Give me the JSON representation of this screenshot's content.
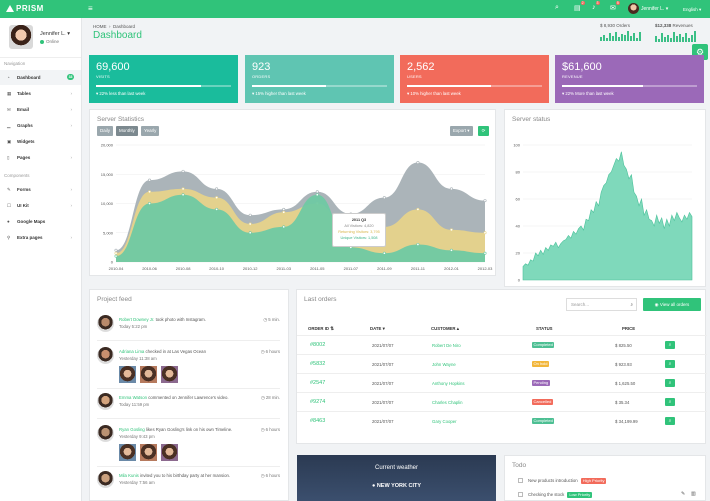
{
  "topbar": {
    "brand": "PRISM",
    "user_name": "Jennifer L.",
    "language": "English",
    "notif_badges": [
      "2",
      "3",
      "5"
    ]
  },
  "sidebar": {
    "user_name": "Jennifer L.",
    "user_status": "Online",
    "nav_heading": "Navigation",
    "components_heading": "Components",
    "items": [
      {
        "label": "Dashboard",
        "icon": "dashboard-icon",
        "badge": "33",
        "active": true
      },
      {
        "label": "Tables",
        "icon": "table-icon"
      },
      {
        "label": "Email",
        "icon": "email-icon"
      },
      {
        "label": "Graphs",
        "icon": "graph-icon"
      },
      {
        "label": "Widgets",
        "icon": "widgets-icon"
      },
      {
        "label": "Pages",
        "icon": "pages-icon"
      }
    ],
    "comp_items": [
      {
        "label": "Forms",
        "icon": "forms-icon"
      },
      {
        "label": "UI Kit",
        "icon": "ui-kit-icon"
      },
      {
        "label": "Google Maps",
        "icon": "map-pin-icon"
      },
      {
        "label": "Extra pages",
        "icon": "extra-pages-icon"
      }
    ]
  },
  "header": {
    "breadcrumb_home": "HOME",
    "breadcrumb_current": "Dashboard",
    "title": "Dashboard",
    "orders_count": "$ 8,930",
    "orders_label": "Orders",
    "revenue_amount": "$12,338",
    "revenue_label": "Revenues"
  },
  "stats": [
    {
      "value": "69,600",
      "label": "VISITS",
      "trend": "22% less than last week",
      "progress": 0.78,
      "color": "#1abc9c"
    },
    {
      "value": "923",
      "label": "ORDERS",
      "trend": "15% higher than last week",
      "progress": 0.55,
      "color": "#5fc5b2"
    },
    {
      "value": "2,562",
      "label": "USERS",
      "trend": "10% higher than last week",
      "progress": 0.62,
      "color": "#f26b5b"
    },
    {
      "value": "$61,600",
      "label": "REVENUE",
      "trend": "22% More than last week",
      "progress": 0.6,
      "color": "#9b69b8"
    }
  ],
  "server_stats": {
    "title": "Server Statistics",
    "tabs": [
      "Daily",
      "Monthly",
      "Yearly"
    ],
    "export_label": "Export",
    "tooltip": {
      "title": "2011 Q3",
      "all": "All Visitors: 4,820",
      "returning": "Returning Visitors: 3,795",
      "unique": "Unique Visitors: 1,508"
    }
  },
  "server_status": {
    "title": "Server status"
  },
  "chart_data": [
    {
      "type": "area",
      "title": "Server Statistics",
      "x": [
        "2010-04",
        "2010-06",
        "2010-08",
        "2010-10",
        "2010-12",
        "2011-03",
        "2011-05",
        "2011-07",
        "2011-09",
        "2011-11",
        "2012-01",
        "2012-03"
      ],
      "ylim": [
        0,
        20000
      ],
      "yticks": [
        "20,000",
        "15,000",
        "10,000",
        "5,000",
        "0"
      ],
      "series": [
        {
          "name": "All Visitors",
          "color": "#a7b0b5",
          "values": [
            2000,
            14000,
            15500,
            12500,
            8000,
            9000,
            12000,
            8200,
            11000,
            17000,
            12500,
            10500
          ]
        },
        {
          "name": "Returning Visitors",
          "color": "#e6d38a",
          "values": [
            1500,
            12000,
            12500,
            11000,
            6500,
            8500,
            10000,
            4500,
            6000,
            9000,
            5500,
            5000
          ]
        },
        {
          "name": "Unique Visitors",
          "color": "#6fc9a3",
          "values": [
            1000,
            10000,
            11500,
            9000,
            5000,
            6000,
            11500,
            2500,
            1500,
            3000,
            2000,
            1500
          ]
        }
      ]
    },
    {
      "type": "area",
      "title": "Server status",
      "ylim": [
        0,
        100
      ],
      "yticks": [
        "100",
        "80",
        "60",
        "40",
        "20",
        "0"
      ],
      "series": [
        {
          "name": "",
          "color": "#7fd9bb",
          "values": [
            10,
            12,
            11,
            15,
            14,
            20,
            18,
            22,
            19,
            24,
            22,
            26,
            25,
            28,
            24,
            27,
            29,
            30,
            33,
            31,
            36,
            34,
            38,
            40,
            37,
            45,
            44,
            52,
            50,
            58,
            55,
            65,
            70,
            72,
            78,
            80,
            85,
            90,
            88,
            95,
            85,
            82,
            75,
            78,
            65,
            62,
            55,
            60,
            48,
            52,
            45,
            44,
            40,
            48,
            42,
            46,
            38,
            45,
            40,
            48,
            44,
            50,
            46,
            43,
            48,
            45,
            50,
            47
          ]
        }
      ]
    }
  ],
  "feed": {
    "title": "Project feed",
    "items": [
      {
        "name": "Robert Downey Jr.",
        "action": "took photo with Instagram.",
        "time": "Today 5:22 pm",
        "ago": "5 min."
      },
      {
        "name": "Adriana Lima",
        "action": "checked in at Las Vegas Ocean",
        "time": "Yesterday 11:38 am",
        "ago": "6 hours"
      },
      {
        "name": "Emma Watson",
        "action": "commented on Jennifer Lawrence's video.",
        "time": "Today 11:59 pm",
        "ago": "28 min."
      },
      {
        "name": "Ryan Gosling",
        "action": "likes Ryan Gosling's link on his own Timeline.",
        "time": "Yesterday 9:43 pm",
        "ago": "6 hours"
      },
      {
        "name": "Mila Kunis",
        "action": "invited you to his birthday party at her mansion.",
        "time": "Yesterday 7:56 am",
        "ago": "6 hours"
      }
    ]
  },
  "orders": {
    "title": "Last orders",
    "search_placeholder": "Search...",
    "view_all": "View all orders",
    "headers": [
      "ORDER ID",
      "DATE",
      "CUSTOMER",
      "STATUS",
      "PRICE"
    ],
    "rows": [
      {
        "id": "#8002",
        "date": "2021/07/07",
        "customer": "Robert De Niro",
        "status": "Completed",
        "status_color": "#4dbf93",
        "price": "$ 825.50"
      },
      {
        "id": "#5832",
        "date": "2021/07/07",
        "customer": "John Wayne",
        "status": "On hold",
        "status_color": "#f2b63a",
        "price": "$ 923.93"
      },
      {
        "id": "#2547",
        "date": "2021/07/07",
        "customer": "Anthony Hopkins",
        "status": "Pending",
        "status_color": "#9b69b8",
        "price": "$ 1,625.50"
      },
      {
        "id": "#9274",
        "date": "2021/07/07",
        "customer": "Charles Chaplin",
        "status": "Cancelled",
        "status_color": "#f26b5b",
        "price": "$ 35.34"
      },
      {
        "id": "#8463",
        "date": "2021/07/07",
        "customer": "Gary Cooper",
        "status": "Completed",
        "status_color": "#4dbf93",
        "price": "$ 34,199.99"
      }
    ]
  },
  "weather": {
    "title": "Current weather",
    "city": "NEW YORK CITY"
  },
  "todos": {
    "title": "Todo",
    "items": [
      {
        "text": "New products introduction",
        "tag": "High Priority",
        "tag_color": "#f26b5b"
      },
      {
        "text": "Checking the stock",
        "tag": "Low Priority",
        "tag_color": "#30c37a"
      }
    ]
  }
}
